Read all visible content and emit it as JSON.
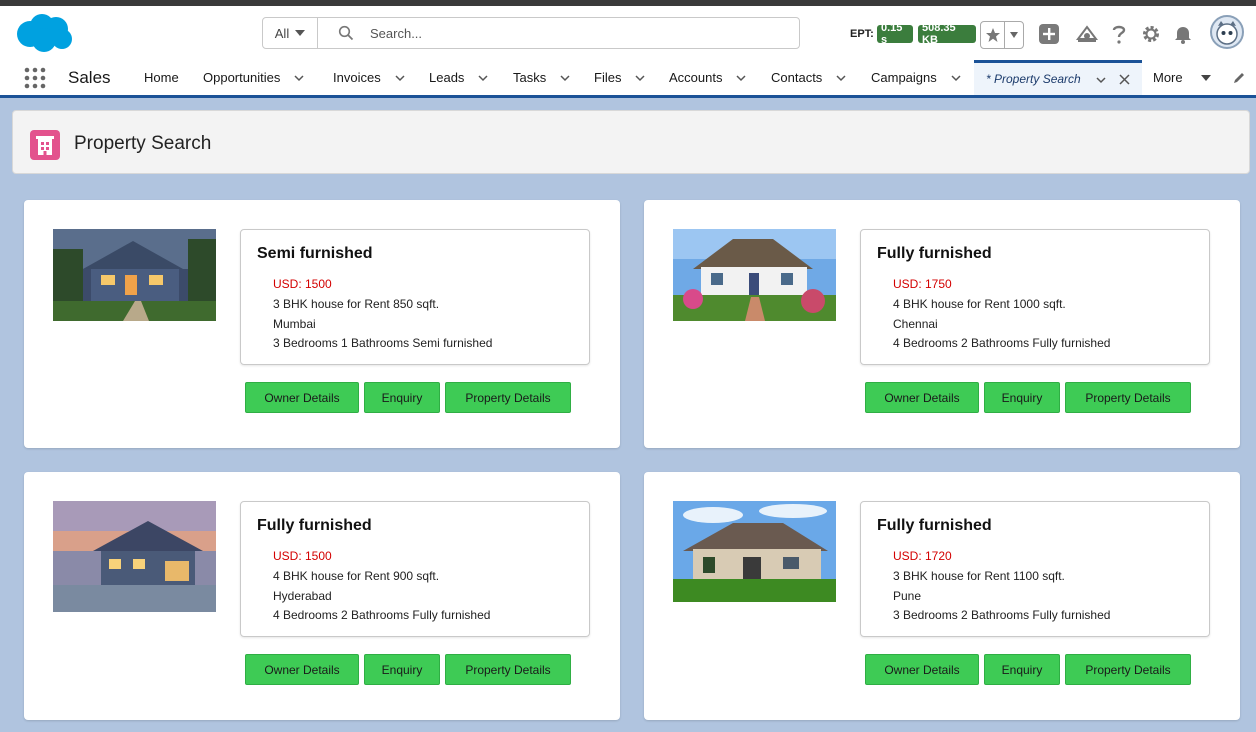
{
  "header": {
    "app_logo": "salesforce-cloud-logo",
    "search_scope": "All",
    "search_placeholder": "Search...",
    "ept_label": "EPT:",
    "ept_value": "0.15 s",
    "page_size": "508.35 KB"
  },
  "nav": {
    "app_name": "Sales",
    "items": [
      {
        "label": "Home",
        "has_menu": false
      },
      {
        "label": "Opportunities",
        "has_menu": true
      },
      {
        "label": "Invoices",
        "has_menu": true
      },
      {
        "label": "Leads",
        "has_menu": true
      },
      {
        "label": "Tasks",
        "has_menu": true
      },
      {
        "label": "Files",
        "has_menu": true
      },
      {
        "label": "Accounts",
        "has_menu": true
      },
      {
        "label": "Contacts",
        "has_menu": true
      },
      {
        "label": "Campaigns",
        "has_menu": true
      }
    ],
    "active_tab": "* Property Search",
    "more_label": "More"
  },
  "page": {
    "title": "Property Search"
  },
  "cards": [
    {
      "furnishing": "Semi furnished",
      "price": "USD: 1500",
      "description": "3 BHK house for Rent 850 sqft.",
      "city": "Mumbai",
      "rooms": "3 Bedrooms 1 Bathrooms Semi furnished",
      "buttons": {
        "owner": "Owner Details",
        "enquiry": "Enquiry",
        "property": "Property Details"
      }
    },
    {
      "furnishing": "Fully furnished",
      "price": "USD: 1750",
      "description": "4 BHK house for Rent 1000 sqft.",
      "city": "Chennai",
      "rooms": "4 Bedrooms 2 Bathrooms Fully furnished",
      "buttons": {
        "owner": "Owner Details",
        "enquiry": "Enquiry",
        "property": "Property Details"
      }
    },
    {
      "furnishing": "Fully furnished",
      "price": "USD: 1500",
      "description": "4 BHK house for Rent 900 sqft.",
      "city": "Hyderabad",
      "rooms": "4 Bedrooms 2 Bathrooms Fully furnished",
      "buttons": {
        "owner": "Owner Details",
        "enquiry": "Enquiry",
        "property": "Property Details"
      }
    },
    {
      "furnishing": "Fully furnished",
      "price": "USD: 1720",
      "description": "3 BHK house for Rent 1100 sqft.",
      "city": "Pune",
      "rooms": "3 Bedrooms 2 Bathrooms Fully furnished",
      "buttons": {
        "owner": "Owner Details",
        "enquiry": "Enquiry",
        "property": "Property Details"
      }
    }
  ],
  "colors": {
    "brand_blue": "#1b5297",
    "button_green": "#3ecb55",
    "price_red": "#d30000",
    "page_icon_pink": "#e3528d"
  }
}
